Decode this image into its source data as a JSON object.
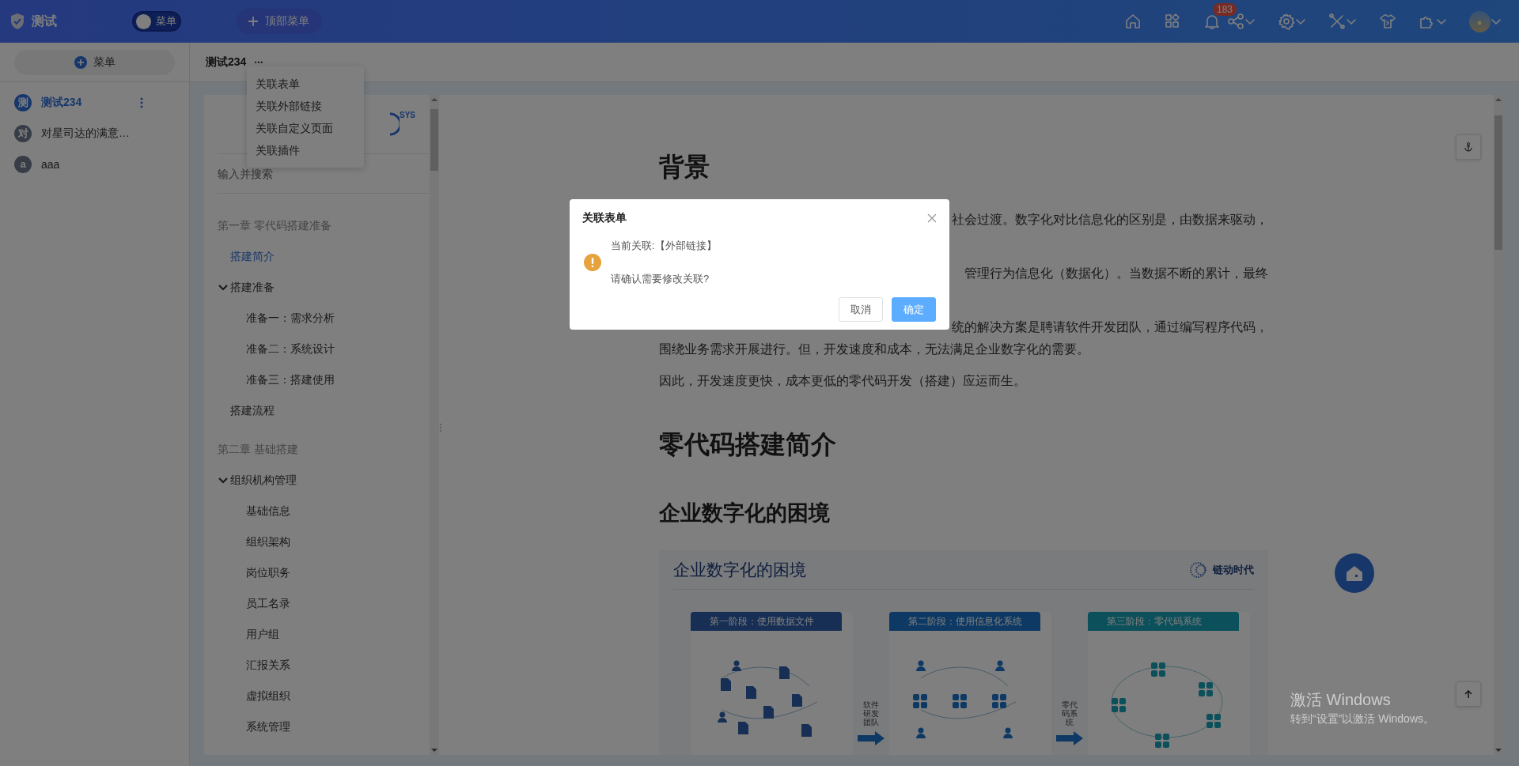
{
  "topbar": {
    "app_title": "测试",
    "menu_switch": {
      "label": "菜单",
      "on": false
    },
    "top_menu_button": "顶部菜单",
    "notification_count": "183"
  },
  "sidebar": {
    "add_button": "菜单",
    "items": [
      {
        "avatar": "测",
        "label": "测试234",
        "selected": true
      },
      {
        "avatar": "对",
        "label": "对星司达的满意…",
        "selected": false
      },
      {
        "avatar": "a",
        "label": "aaa",
        "selected": false
      }
    ]
  },
  "page_header": {
    "title": "测试234",
    "more": "···"
  },
  "dropdown": {
    "items": [
      "关联表单",
      "关联外部链接",
      "关联自定义页面",
      "关联插件"
    ]
  },
  "toc": {
    "logo_text": "SYS",
    "search_placeholder": "输入并搜索",
    "chapters": [
      {
        "title": "第一章 零代码搭建准备",
        "items": [
          {
            "label": "搭建简介",
            "selected": true
          },
          {
            "label": "搭建准备",
            "selected": false,
            "expanded": true,
            "children": [
              {
                "label": "准备一：需求分析",
                "selected": false
              },
              {
                "label": "准备二：系统设计",
                "selected": false
              },
              {
                "label": "准备三：搭建使用",
                "selected": false
              }
            ]
          },
          {
            "label": "搭建流程",
            "selected": false
          }
        ]
      },
      {
        "title": "第二章 基础搭建",
        "items": [
          {
            "label": "组织机构管理",
            "selected": false,
            "expanded": true,
            "children": [
              {
                "label": "基础信息",
                "selected": false
              },
              {
                "label": "组织架构",
                "selected": false
              },
              {
                "label": "岗位职务",
                "selected": false
              },
              {
                "label": "员工名录",
                "selected": false
              },
              {
                "label": "用户组",
                "selected": false
              },
              {
                "label": "汇报关系",
                "selected": false
              },
              {
                "label": "虚拟组织",
                "selected": false
              },
              {
                "label": "系统管理",
                "selected": false
              }
            ]
          }
        ]
      }
    ]
  },
  "document": {
    "blocks": [
      {
        "kind": "heading1",
        "text": "背景"
      },
      {
        "kind": "para",
        "lines": [
          {
            "text": "社会过渡。数字化对比信息化的区别是，由数据来驱动，",
            "kind": "fragment"
          }
        ]
      },
      {
        "kind": "para",
        "lines": [
          {
            "text": "管理行为信息化（数据化）。当数据不断的累计，最终",
            "kind": "fragment"
          }
        ]
      },
      {
        "kind": "para",
        "lines": [
          {
            "text": "统的解决方案是聘请软件开发团队，通过编写程序代码，",
            "kind": "fragment"
          },
          {
            "text": "围绕业务需求开展进行。但，开发速度和成本，无法满足企业数字化的需要。",
            "kind": "full"
          }
        ]
      },
      {
        "kind": "para",
        "lines": [
          {
            "text": "因此，开发速度更快，成本更低的零代码开发（搭建）应运而生。",
            "kind": "full"
          }
        ]
      },
      {
        "kind": "heading1",
        "text": "零代码搭建简介"
      },
      {
        "kind": "heading2",
        "text": "企业数字化的困境"
      },
      {
        "kind": "figure",
        "title": "企业数字化的困境",
        "logo_text": "链动时代",
        "stages": [
          {
            "title": "第一阶段：使用数据文件",
            "kind": "files",
            "connector": "软件研发团队"
          },
          {
            "title": "第二阶段：使用信息化系统",
            "kind": "system",
            "connector": "零代码系统"
          },
          {
            "title": "第三阶段：零代码系统",
            "kind": "nocode"
          }
        ]
      }
    ]
  },
  "dialog": {
    "title": "关联表单",
    "message_lines": [
      "当前关联:【外部链接】",
      "请确认需要修改关联?"
    ],
    "buttons": [
      {
        "label": "取消",
        "kind": "default"
      },
      {
        "label": "确定",
        "kind": "primary"
      }
    ]
  },
  "windows_notice": {
    "title": "激活 Windows",
    "subtitle": "转到“设置”以激活 Windows。"
  }
}
